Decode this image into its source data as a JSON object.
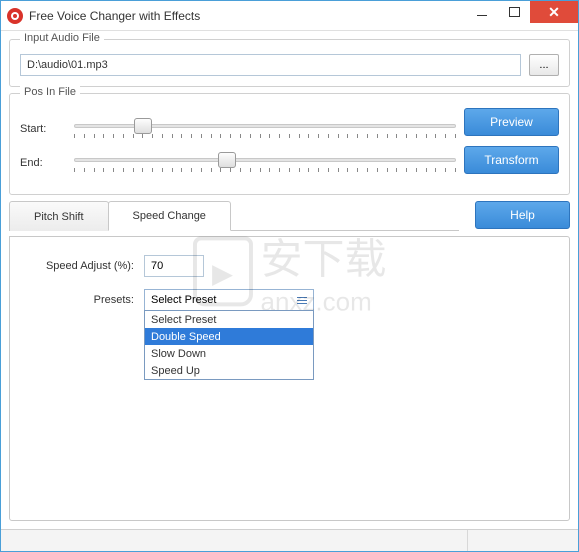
{
  "window": {
    "title": "Free Voice Changer with Effects"
  },
  "input": {
    "legend": "Input Audio File",
    "path": "D:\\audio\\01.mp3",
    "browse": "..."
  },
  "pos": {
    "legend": "Pos In File",
    "start_label": "Start:",
    "end_label": "End:",
    "start_pct": 18,
    "end_pct": 40
  },
  "buttons": {
    "preview": "Preview",
    "transform": "Transform",
    "help": "Help"
  },
  "tabs": {
    "pitch": "Pitch Shift",
    "speed": "Speed Change"
  },
  "speed": {
    "adjust_label": "Speed Adjust (%):",
    "adjust_value": "70",
    "presets_label": "Presets:",
    "selected": "Select Preset",
    "options": [
      "Select Preset",
      "Double Speed",
      "Slow Down",
      "Speed Up"
    ],
    "highlighted_index": 1
  },
  "watermark": {
    "line1": "安下载",
    "line2": "anxz.com"
  }
}
